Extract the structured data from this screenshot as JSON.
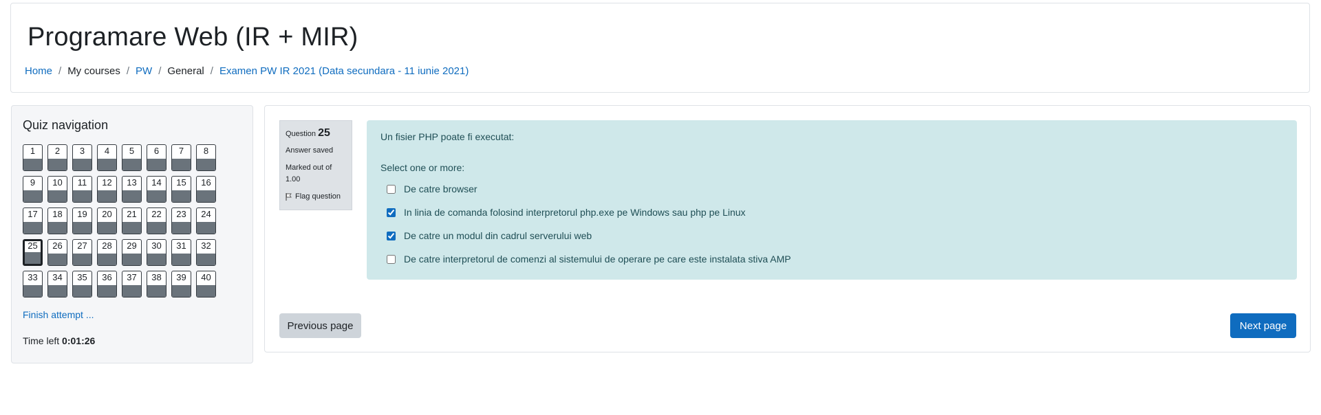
{
  "header": {
    "title": "Programare Web (IR + MIR)",
    "breadcrumb": [
      {
        "label": "Home",
        "link": true
      },
      {
        "label": "My courses",
        "link": false
      },
      {
        "label": "PW",
        "link": true
      },
      {
        "label": "General",
        "link": false
      },
      {
        "label": "Examen PW IR 2021 (Data secundara - 11 iunie 2021)",
        "link": true
      }
    ]
  },
  "quiz_nav": {
    "title": "Quiz navigation",
    "questions": [
      "1",
      "2",
      "3",
      "4",
      "5",
      "6",
      "7",
      "8",
      "9",
      "10",
      "11",
      "12",
      "13",
      "14",
      "15",
      "16",
      "17",
      "18",
      "19",
      "20",
      "21",
      "22",
      "23",
      "24",
      "25",
      "26",
      "27",
      "28",
      "29",
      "30",
      "31",
      "32",
      "33",
      "34",
      "35",
      "36",
      "37",
      "38",
      "39",
      "40"
    ],
    "current": "25",
    "finish_label": "Finish attempt ...",
    "time_label": "Time left",
    "time_value": "0:01:26"
  },
  "question": {
    "label": "Question",
    "number": "25",
    "status": "Answer saved",
    "marked": "Marked out of 1.00",
    "flag_label": "Flag question",
    "text": "Un fisier PHP poate fi executat:",
    "prompt": "Select one or more:",
    "options": [
      {
        "label": "De catre browser",
        "checked": false
      },
      {
        "label": "In linia de comanda folosind interpretorul php.exe pe Windows sau php pe Linux",
        "checked": true
      },
      {
        "label": "De catre un modul din cadrul serverului web",
        "checked": true
      },
      {
        "label": "De catre interpretorul de comenzi al sistemului de operare pe care este instalata stiva AMP",
        "checked": false
      }
    ]
  },
  "nav_buttons": {
    "previous": "Previous page",
    "next": "Next page"
  },
  "colors": {
    "link": "#0f6cbf",
    "formulation_bg": "#cfe8ea",
    "answered_state": "#6a737b",
    "info_bg": "#dee2e6"
  }
}
